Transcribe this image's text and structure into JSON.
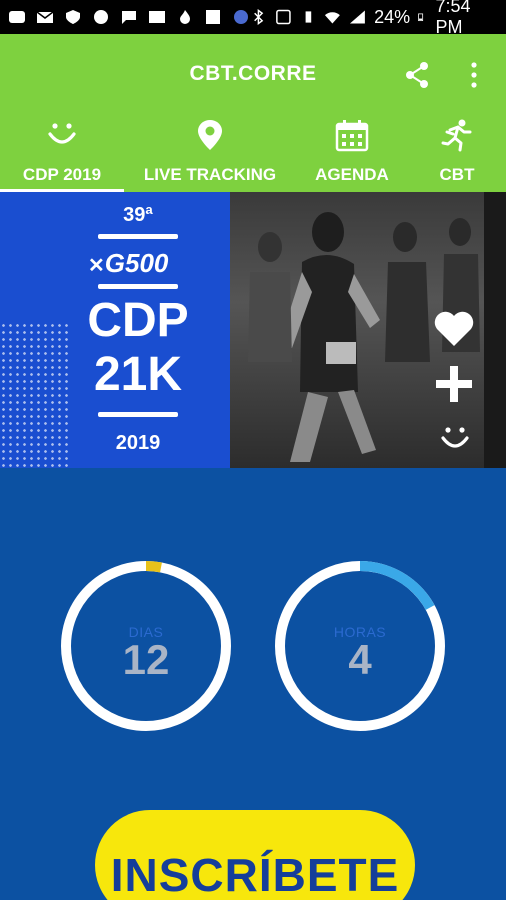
{
  "status_bar": {
    "battery": "24%",
    "time": "7:54 PM"
  },
  "app_bar": {
    "title": "CBT.CORRE"
  },
  "tabs": [
    {
      "label": "CDP 2019",
      "icon": "smiley-icon",
      "active": true
    },
    {
      "label": "LIVE TRACKING",
      "icon": "location-pin-icon",
      "active": false
    },
    {
      "label": "AGENDA",
      "icon": "calendar-icon",
      "active": false
    },
    {
      "label": "CBT",
      "icon": "runner-icon",
      "active": false
    }
  ],
  "banner": {
    "edition": "39ª",
    "brand": "G500",
    "line1": "CDP",
    "line2": "21K",
    "year": "2019"
  },
  "countdown": {
    "days": {
      "label": "DIAS",
      "value": "12",
      "progress": 0.03
    },
    "hours": {
      "label": "HORAS",
      "value": "4",
      "progress": 0.17
    }
  },
  "cta": {
    "label": "INSCRÍBETE"
  },
  "colors": {
    "green": "#7ed13f",
    "blue": "#0c51a2",
    "yellow": "#f7e70c",
    "ring_accent_days": "#e8c21a",
    "ring_accent_hours": "#3aa8e8"
  }
}
